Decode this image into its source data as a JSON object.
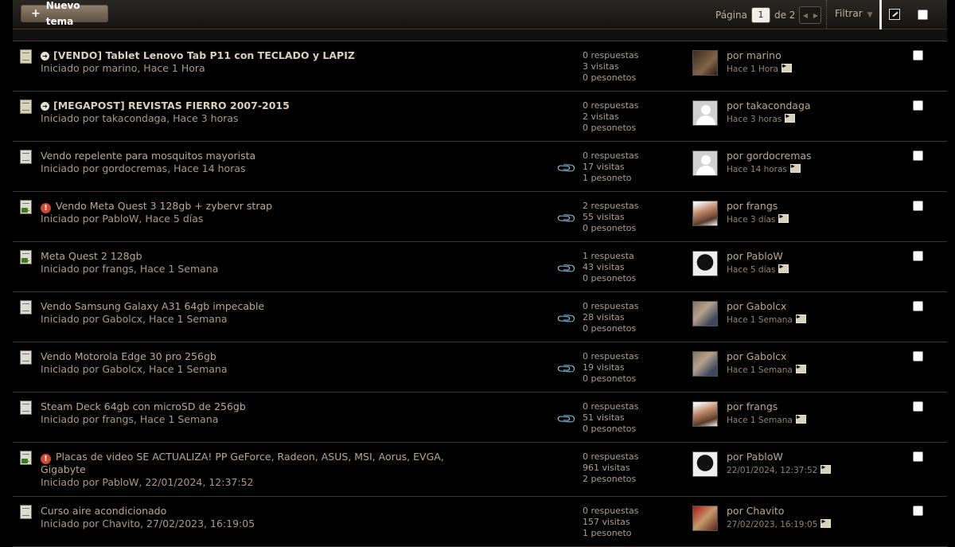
{
  "toolbar": {
    "new_topic_label": "Nuevo tema",
    "page_label": "Página",
    "page_value": "1",
    "page_of": "de 2",
    "filter_label": "Filtrar"
  },
  "threads": [
    {
      "title": "[VENDO] Tablet Lenovo Tab P11 con TECLADO y LAPIZ",
      "started": "Iniciado por marino, Hace 1 Hora",
      "replies": "0 respuestas",
      "views": "3 visitas",
      "pesonetos": "0 pesonetos",
      "last_by": "por marino",
      "last_time": "Hace 1 Hora"
    },
    {
      "title": "[MEGAPOST] REVISTAS FIERRO 2007-2015",
      "started": "Iniciado por takacondaga, Hace 3 horas",
      "replies": "0 respuestas",
      "views": "2 visitas",
      "pesonetos": "0 pesonetos",
      "last_by": "por takacondaga",
      "last_time": "Hace 3 horas"
    },
    {
      "title": "Vendo repelente para mosquitos mayorista",
      "started": "Iniciado por gordocremas, Hace 14 horas",
      "replies": "0 respuestas",
      "views": "17 visitas",
      "pesonetos": "1 pesoneto",
      "last_by": "por gordocremas",
      "last_time": "Hace 14 horas"
    },
    {
      "title": "Vendo Meta Quest 3 128gb + zybervr strap",
      "started": "Iniciado por PabloW, Hace 5 días",
      "replies": "2 respuestas",
      "views": "55 visitas",
      "pesonetos": "0 pesonetos",
      "last_by": "por frangs",
      "last_time": "Hace 3 días"
    },
    {
      "title": "Meta Quest 2 128gb",
      "started": "Iniciado por frangs, Hace 1 Semana",
      "replies": "1 respuesta",
      "views": "43 visitas",
      "pesonetos": "0 pesonetos",
      "last_by": "por PabloW",
      "last_time": "Hace 5 días"
    },
    {
      "title": "Vendo Samsung Galaxy A31 64gb impecable",
      "started": "Iniciado por Gabolcx, Hace 1 Semana",
      "replies": "0 respuestas",
      "views": "28 visitas",
      "pesonetos": "0 pesonetos",
      "last_by": "por Gabolcx",
      "last_time": "Hace 1 Semana"
    },
    {
      "title": "Vendo Motorola Edge 30 pro 256gb",
      "started": "Iniciado por Gabolcx, Hace 1 Semana",
      "replies": "0 respuestas",
      "views": "19 visitas",
      "pesonetos": "0 pesonetos",
      "last_by": "por Gabolcx",
      "last_time": "Hace 1 Semana"
    },
    {
      "title": "Steam Deck 64gb con microSD de 256gb",
      "started": "Iniciado por frangs, Hace 1 Semana",
      "replies": "0 respuestas",
      "views": "51 visitas",
      "pesonetos": "0 pesonetos",
      "last_by": "por frangs",
      "last_time": "Hace 1 Semana"
    },
    {
      "title": "Placas de video SE ACTUALIZA! PP GeForce, Radeon, ASUS, MSI, Aorus, EVGA,",
      "title_cont": "Gigabyte",
      "started": "Iniciado por PabloW, 22/01/2024, 12:37:52",
      "replies": "0 respuestas",
      "views": "961 visitas",
      "pesonetos": "2 pesonetos",
      "last_by": "por PabloW",
      "last_time": "22/01/2024, 12:37:52"
    },
    {
      "title": "Curso aire acondicionado",
      "started": "Iniciado por Chavito, 27/02/2023, 16:19:05",
      "replies": "0 respuestas",
      "views": "157 visitas",
      "pesonetos": "1 pesoneto",
      "last_by": "por Chavito",
      "last_time": "27/02/2023, 16:19:05"
    }
  ],
  "icons": {
    "attachment": "paperclip-icon",
    "go_last": "go-to-last-post-icon",
    "sticky_marker": "sticky-arrow-icon",
    "alert_marker": "alert-icon"
  },
  "colors": {
    "background": "#000000",
    "link": "#b9a98d",
    "alert": "#d0482e"
  }
}
